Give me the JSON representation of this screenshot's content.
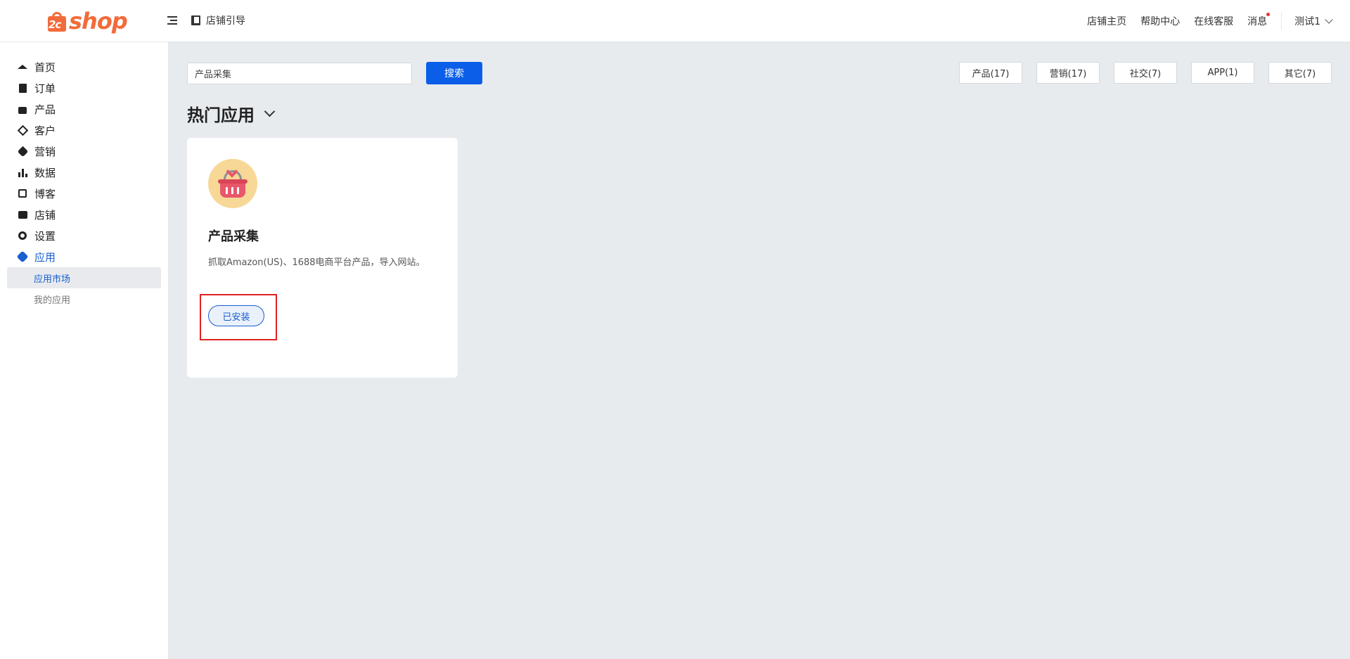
{
  "header": {
    "logo_text": "shop",
    "logo_badge": "2c",
    "guide_label": "店铺引导",
    "links": {
      "store_home": "店铺主页",
      "help_center": "帮助中心",
      "online_support": "在线客服",
      "messages": "消息"
    },
    "user_name": "测试1",
    "colors": {
      "brand": "#f26b3a"
    }
  },
  "sidebar": {
    "items": [
      {
        "label": "首页",
        "icon": "home-icon"
      },
      {
        "label": "订单",
        "icon": "clipboard-icon"
      },
      {
        "label": "产品",
        "icon": "shopping-bag-icon"
      },
      {
        "label": "客户",
        "icon": "gem-icon"
      },
      {
        "label": "营销",
        "icon": "tag-icon"
      },
      {
        "label": "数据",
        "icon": "bar-chart-icon"
      },
      {
        "label": "博客",
        "icon": "edit-icon"
      },
      {
        "label": "店铺",
        "icon": "store-icon"
      },
      {
        "label": "设置",
        "icon": "gear-icon"
      },
      {
        "label": "应用",
        "icon": "puzzle-icon",
        "active": true
      }
    ],
    "sub_items": [
      {
        "label": "应用市场",
        "active": true
      },
      {
        "label": "我的应用",
        "active": false
      }
    ],
    "colors": {
      "active": "#1a5fd0"
    }
  },
  "main": {
    "search": {
      "value": "产品采集",
      "button_label": "搜索"
    },
    "category_tabs": [
      {
        "label": "产品(17)"
      },
      {
        "label": "营销(17)"
      },
      {
        "label": "社交(7)"
      },
      {
        "label": "APP(1)"
      },
      {
        "label": "其它(7)"
      }
    ],
    "section_title": "热门应用",
    "app_card": {
      "name": "产品采集",
      "description": "抓取Amazon(US)、1688电商平台产品，导入网站。",
      "icon": "shopping-basket-icon",
      "status_label": "已安装"
    }
  }
}
